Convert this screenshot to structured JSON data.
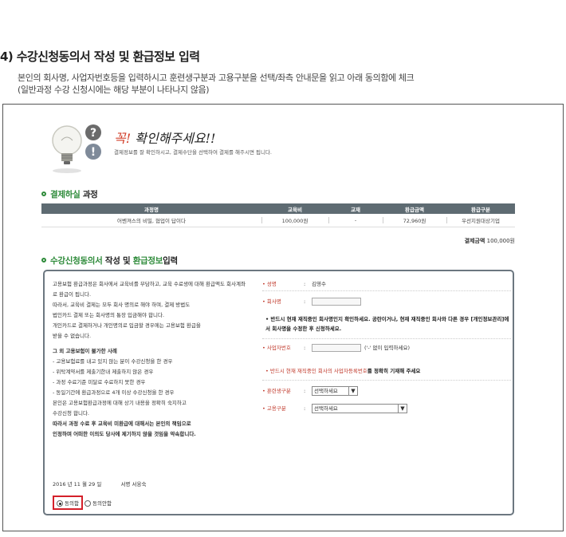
{
  "heading": "4) 수강신청동의서 작성 및 환급정보 입력",
  "description": [
    "본인의 회사명, 사업자번호등을 입력하시고 훈련생구분과 고용구분을 선택/좌측 안내문을 읽고 아래 동의함에 체크",
    "(일반과정 수강 신청시에는 해당 부분이 나타나지 않음)"
  ],
  "notice": {
    "title_red": "꼭!",
    "title_rest": "확인해주세요!!",
    "subtitle": "결제정보를 잘 확인하시고, 결제수단을 선택하여 결제를 해주시면 됩니다."
  },
  "payment": {
    "title_green": "결제하실",
    "title_rest": "과정",
    "headers": [
      "과정명",
      "교육비",
      "교재",
      "환급금액",
      "환급구분"
    ],
    "row": [
      "어벤져스의 비밀, 협업이 답이다",
      "100,000원",
      "-",
      "72,960원",
      "우선지원대상기업"
    ],
    "total_label": "결제금액",
    "total_value": "100,000원"
  },
  "agreement": {
    "title_green1": "수강신청동의서",
    "title_mid": "작성 및",
    "title_green2": "환급정보",
    "title_rest": "입력",
    "terms": [
      {
        "text": "고용보험 환급과정은 회사에서 교육비를 부담하고, 교육 수료생에 대해 환급액도 회사계좌",
        "bold": false,
        "gap": false
      },
      {
        "text": "로 환급이 됩니다.",
        "bold": false,
        "gap": false
      },
      {
        "text": "따라서, 교육비 결제는 모두 회사 명의로 해야 하며, 결제 방법도",
        "bold": false,
        "gap": false
      },
      {
        "text": "법인카드 결제 또는 회사명의 통장 입금해야 합니다.",
        "bold": false,
        "gap": false
      },
      {
        "text": "개인카드로 결제하거나 개인명의로 입금할 경우에는 고용보험 환급을",
        "bold": false,
        "gap": false
      },
      {
        "text": "받을 수 없습니다.",
        "bold": false,
        "gap": false
      },
      {
        "text": "그 외 고용보험이 불가한 사례",
        "bold": true,
        "gap": true
      },
      {
        "text": "- 고용보험료를 내고 있지 않는 분이 수강신청을 한 경우",
        "bold": false,
        "gap": false
      },
      {
        "text": "- 위탁계약서를 제출기한내 제출하지 않은 경우",
        "bold": false,
        "gap": false
      },
      {
        "text": "- 과정 수료기준 미달로 수료하지 못한 경우",
        "bold": false,
        "gap": false
      },
      {
        "text": "- 동일기간에 환급과정으로 4개 이상 수강신청을 한 경우",
        "bold": false,
        "gap": false
      },
      {
        "text": "본인은 고용보험환급과정에 대해 상기 내용을 정확히 숙지하고",
        "bold": false,
        "gap": false
      },
      {
        "text": "수강신청 합니다.",
        "bold": false,
        "gap": false
      },
      {
        "text": "따라서 과정 수료 후 교육비 미환급에 대해서는 본인의 책임으로",
        "bold": true,
        "gap": false
      },
      {
        "text": "인정하며 어떠한 이의도 당사에 제기하지 않을 것임을 약속합니다.",
        "bold": true,
        "gap": false
      }
    ],
    "date": "2016 년 11 월 29 일",
    "sign_label": "서명",
    "sign_name": "서융숙",
    "agree_label": "동의함",
    "disagree_label": "동의안함"
  },
  "fields": {
    "name_label": "• 성명",
    "name_value": "김영수",
    "company_label": "• 회사명",
    "company_info": "• 반드시 현재 재직중인 회사명인지 확인하세요. 공란이거나, 현재 재직중인 회사와 다른 경우 [개인정보관리]에서 회사명을 수정한 후 신청하세요.",
    "bizno_label": "• 사업자번호",
    "bizno_note": "('-' 없이 입력하세요)",
    "bizno_info_red": "• 반드시 현재 재직중인 회사의 사업자등록번호",
    "bizno_info_black": "를 정확히 기재해 주세요",
    "trainee_label": "• 훈련생구분",
    "trainee_value": "선택하세요",
    "employ_label": "• 고용구분",
    "employ_value": "선택하세요",
    "colon": ":"
  }
}
